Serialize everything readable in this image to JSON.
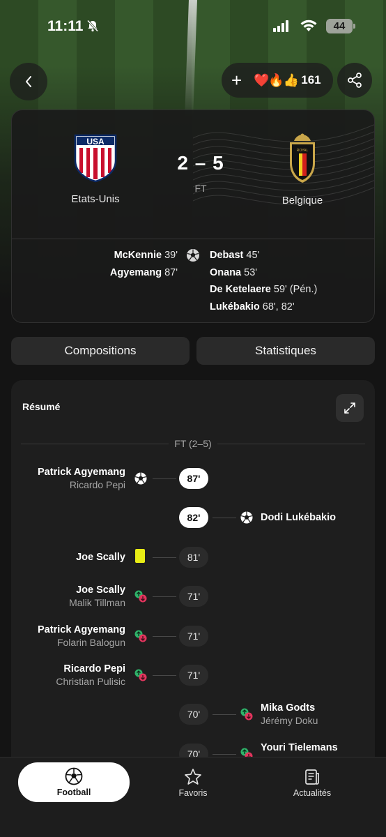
{
  "status_bar": {
    "time": "11:11",
    "battery": "44"
  },
  "header": {
    "reaction_emojis": "❤️🔥👍",
    "reaction_count": "161"
  },
  "match": {
    "home_team": "Etats-Unis",
    "away_team": "Belgique",
    "score": "2 – 5",
    "status": "FT",
    "home_scorers": [
      {
        "name": "McKennie",
        "minutes": "39'"
      },
      {
        "name": "Agyemang",
        "minutes": "87'"
      }
    ],
    "away_scorers": [
      {
        "name": "Debast",
        "minutes": "45'"
      },
      {
        "name": "Onana",
        "minutes": "53'"
      },
      {
        "name": "De Ketelaere",
        "minutes": "59' (Pén.)"
      },
      {
        "name": "Lukébakio",
        "minutes": "68', 82'"
      }
    ]
  },
  "tabs": {
    "compositions": "Compositions",
    "statistics": "Statistiques"
  },
  "summary": {
    "title": "Résumé",
    "period_label": "FT (2–5)",
    "events": [
      {
        "side": "home",
        "type": "goal",
        "minute": "87'",
        "primary": "Patrick Agyemang",
        "secondary": "Ricardo Pepi"
      },
      {
        "side": "away",
        "type": "goal",
        "minute": "82'",
        "primary": "Dodi Lukébakio",
        "secondary": ""
      },
      {
        "side": "home",
        "type": "yellow-card",
        "minute": "81'",
        "primary": "Joe Scally",
        "secondary": ""
      },
      {
        "side": "home",
        "type": "substitution",
        "minute": "71'",
        "primary": "Joe Scally",
        "secondary": "Malik Tillman"
      },
      {
        "side": "home",
        "type": "substitution",
        "minute": "71'",
        "primary": "Patrick Agyemang",
        "secondary": "Folarin Balogun"
      },
      {
        "side": "home",
        "type": "substitution",
        "minute": "71'",
        "primary": "Ricardo Pepi",
        "secondary": "Christian Pulisic"
      },
      {
        "side": "away",
        "type": "substitution",
        "minute": "70'",
        "primary": "Mika Godts",
        "secondary": "Jérémy Doku"
      },
      {
        "side": "away",
        "type": "substitution",
        "minute": "70'",
        "primary": "Youri Tielemans",
        "secondary": ""
      }
    ]
  },
  "bottom_nav": [
    {
      "label": "Football",
      "icon": "football-icon",
      "active": true
    },
    {
      "label": "Favoris",
      "icon": "star-icon",
      "active": false
    },
    {
      "label": "Actualités",
      "icon": "news-icon",
      "active": false
    }
  ],
  "colors": {
    "background": "#141414",
    "card": "#1e1e1e",
    "yellow_card": "#e8ec15",
    "sub_in": "#2fb36a",
    "sub_out": "#e0355d"
  }
}
